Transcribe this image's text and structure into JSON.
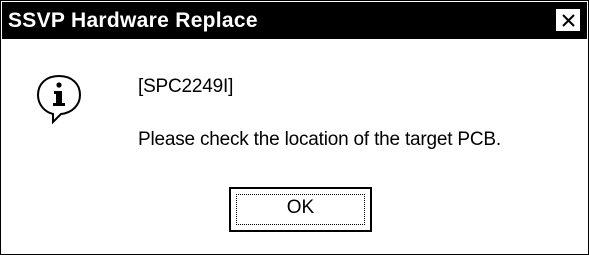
{
  "window": {
    "title": "SSVP Hardware Replace",
    "close_icon": "close-icon"
  },
  "message": {
    "icon": "info-icon",
    "code": "[SPC2249I]",
    "text": "Please check the location of the target PCB."
  },
  "buttons": {
    "ok_label": "OK"
  },
  "colors": {
    "title_bar_bg": "#000000",
    "title_bar_fg": "#ffffff",
    "dialog_bg": "#ffffff"
  }
}
